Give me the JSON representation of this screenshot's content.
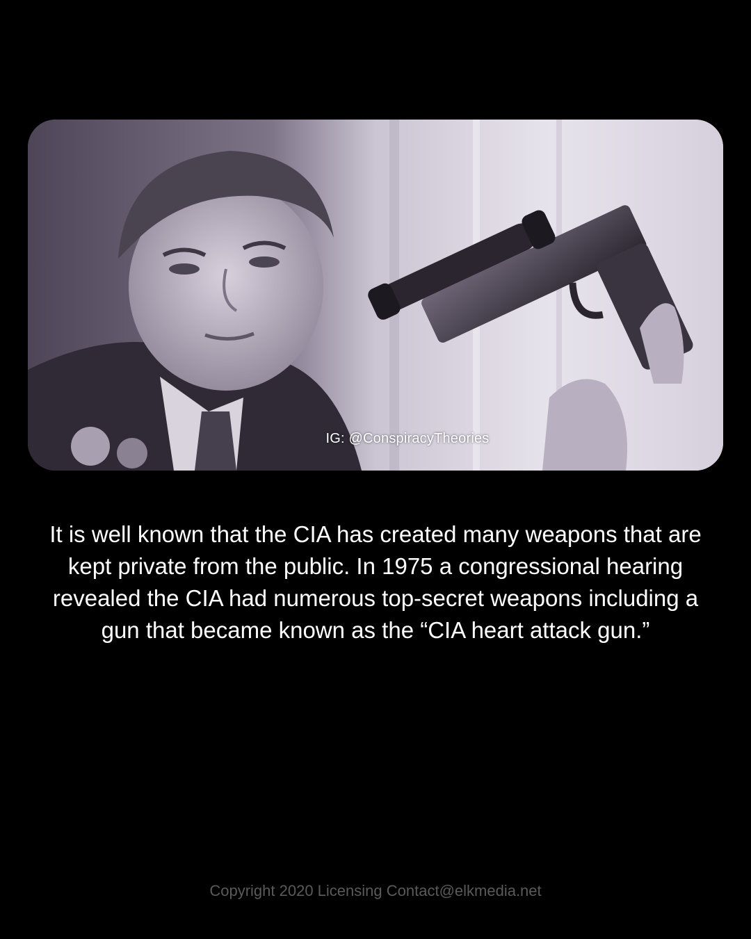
{
  "photo": {
    "description_icon": "hearing-photo",
    "watermark": "IG: @ConspiracyTheories"
  },
  "caption": "It is well known that the CIA has created many weapons that are kept private from the public. In 1975 a congressional hearing revealed the CIA had numerous top-secret weapons including a gun that became known as the “CIA heart attack gun.”",
  "footer": {
    "copyright": "Copyright 2020 Licensing Contact@elkmedia.net"
  },
  "colors": {
    "background": "#000000",
    "caption_text": "#ffffff",
    "footer_text": "#5a5a5a"
  }
}
